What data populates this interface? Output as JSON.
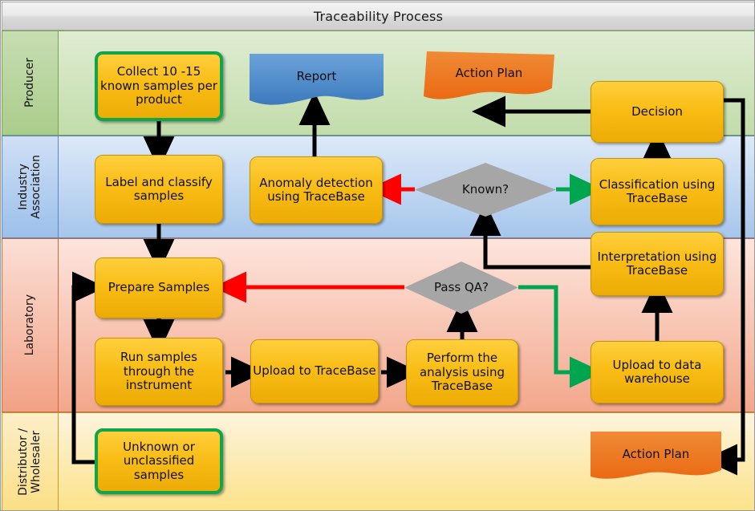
{
  "title": "Traceability Process",
  "lanes": [
    {
      "id": "producer",
      "label": "Producer"
    },
    {
      "id": "industry",
      "label": "Industry\nAssociation"
    },
    {
      "id": "lab",
      "label": "Laboratory"
    },
    {
      "id": "distributor",
      "label": "Distributor /\nWholesaler"
    }
  ],
  "nodes": {
    "collect": "Collect 10 -15 known samples per product",
    "report": "Report",
    "action_plan_top": "Action Plan",
    "decision": "Decision",
    "label_classify": "Label and classify samples",
    "anomaly": "Anomaly detection using TraceBase",
    "known": "Known?",
    "classification": "Classification using TraceBase",
    "prepare": "Prepare Samples",
    "pass_qa": "Pass QA?",
    "interpretation": "Interpretation using TraceBase",
    "run_samples": "Run samples through the instrument",
    "upload_trace": "Upload to TraceBase",
    "perform": "Perform the analysis using TraceBase",
    "upload_wh": "Upload to data warehouse",
    "unknown": "Unknown or unclassified samples",
    "action_plan_bottom": "Action Plan"
  },
  "colors": {
    "process_fill": "#f8bc14",
    "process_border": "#c79400",
    "highlight_border": "#11a54a",
    "decision_fill": "#a6a6a6",
    "document_blue": "#4a86c8",
    "document_orange": "#ee7224",
    "flow_black": "#000000",
    "flow_red": "#ff0000",
    "flow_green": "#00a550",
    "lane_producer": "#c2dcaa",
    "lane_industry": "#a6c6ec",
    "lane_lab": "#f3a78b",
    "lane_distributor": "#fce289"
  }
}
